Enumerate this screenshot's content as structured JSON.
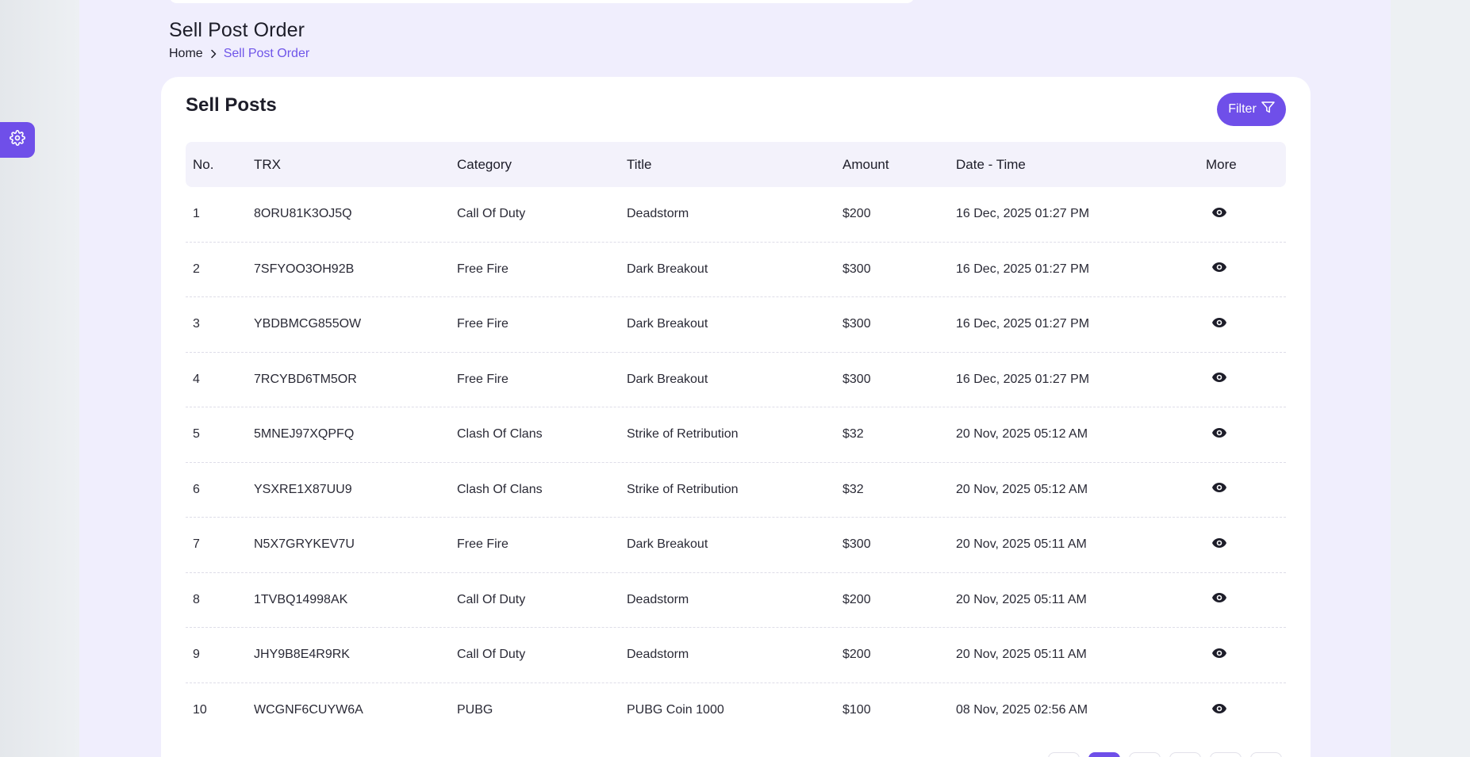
{
  "header": {
    "page_title": "Sell Post Order",
    "breadcrumb": {
      "home": "Home",
      "current": "Sell Post Order"
    }
  },
  "card": {
    "title": "Sell Posts",
    "filter_label": "Filter"
  },
  "table": {
    "columns": [
      "No.",
      "TRX",
      "Category",
      "Title",
      "Amount",
      "Date - Time",
      "More"
    ],
    "rows": [
      {
        "no": "1",
        "trx": "8ORU81K3OJ5Q",
        "category": "Call Of Duty",
        "title": "Deadstorm",
        "amount": "$200",
        "datetime": "16 Dec, 2025 01:27 PM"
      },
      {
        "no": "2",
        "trx": "7SFYOO3OH92B",
        "category": "Free Fire",
        "title": "Dark Breakout",
        "amount": "$300",
        "datetime": "16 Dec, 2025 01:27 PM"
      },
      {
        "no": "3",
        "trx": "YBDBMCG855OW",
        "category": "Free Fire",
        "title": "Dark Breakout",
        "amount": "$300",
        "datetime": "16 Dec, 2025 01:27 PM"
      },
      {
        "no": "4",
        "trx": "7RCYBD6TM5OR",
        "category": "Free Fire",
        "title": "Dark Breakout",
        "amount": "$300",
        "datetime": "16 Dec, 2025 01:27 PM"
      },
      {
        "no": "5",
        "trx": "5MNEJ97XQPFQ",
        "category": "Clash Of Clans",
        "title": "Strike of Retribution",
        "amount": "$32",
        "datetime": "20 Nov, 2025 05:12 AM"
      },
      {
        "no": "6",
        "trx": "YSXRE1X87UU9",
        "category": "Clash Of Clans",
        "title": "Strike of Retribution",
        "amount": "$32",
        "datetime": "20 Nov, 2025 05:12 AM"
      },
      {
        "no": "7",
        "trx": "N5X7GRYKEV7U",
        "category": "Free Fire",
        "title": "Dark Breakout",
        "amount": "$300",
        "datetime": "20 Nov, 2025 05:11 AM"
      },
      {
        "no": "8",
        "trx": "1TVBQ14998AK",
        "category": "Call Of Duty",
        "title": "Deadstorm",
        "amount": "$200",
        "datetime": "20 Nov, 2025 05:11 AM"
      },
      {
        "no": "9",
        "trx": "JHY9B8E4R9RK",
        "category": "Call Of Duty",
        "title": "Deadstorm",
        "amount": "$200",
        "datetime": "20 Nov, 2025 05:11 AM"
      },
      {
        "no": "10",
        "trx": "WCGNF6CUYW6A",
        "category": "PUBG",
        "title": "PUBG Coin 1000",
        "amount": "$100",
        "datetime": "08 Nov, 2025 02:56 AM"
      }
    ]
  },
  "icons": {
    "settings": "gear-icon",
    "filter": "filter-icon",
    "view": "eye-icon",
    "breadcrumb_sep": "chevron-right-icon"
  },
  "colors": {
    "accent": "#6f4fe9",
    "breadcrumb_active": "#6f55e9",
    "page_background": "#f0eefd",
    "table_header": "#f3f2fb"
  }
}
